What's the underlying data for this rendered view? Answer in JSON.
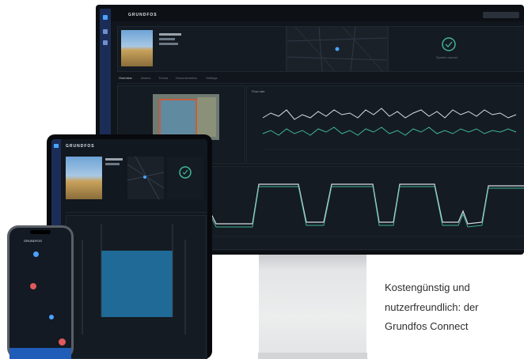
{
  "caption": {
    "line1": "Kostengünstig und",
    "line2": "nutzerfreundlich: der",
    "line3": "Grundfos Connect"
  },
  "monitor": {
    "brand": "GRUNDFOS",
    "nav_tabs": [
      "Overview",
      "Alarms",
      "Trends",
      "Documentation",
      "Settings"
    ],
    "status_label": "System normal",
    "chart_title": "Flow rate",
    "colors": {
      "accent": "#4aa3ff",
      "series1": "#d8dde2",
      "series2": "#3fb59a",
      "background": "#11161c"
    }
  },
  "tablet": {
    "brand": "GRUNDFOS"
  },
  "phone": {
    "brand": "GRUNDFOS"
  }
}
